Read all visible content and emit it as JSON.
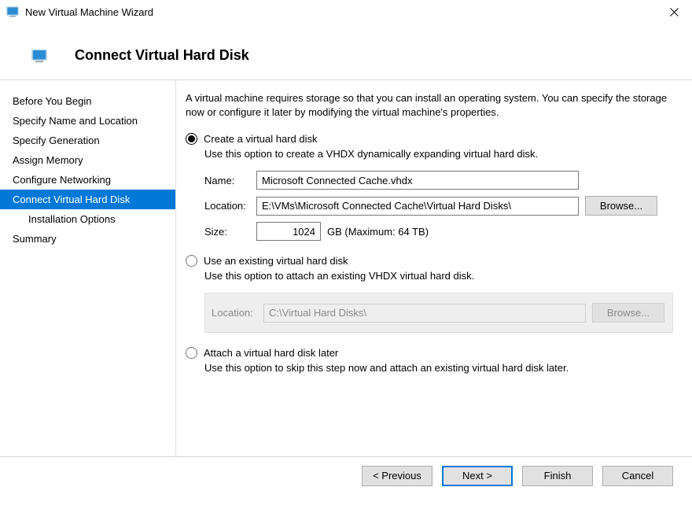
{
  "titlebar": {
    "title": "New Virtual Machine Wizard"
  },
  "header": {
    "heading": "Connect Virtual Hard Disk"
  },
  "sidebar": {
    "items": [
      {
        "label": "Before You Begin",
        "selected": false,
        "indented": false
      },
      {
        "label": "Specify Name and Location",
        "selected": false,
        "indented": false
      },
      {
        "label": "Specify Generation",
        "selected": false,
        "indented": false
      },
      {
        "label": "Assign Memory",
        "selected": false,
        "indented": false
      },
      {
        "label": "Configure Networking",
        "selected": false,
        "indented": false
      },
      {
        "label": "Connect Virtual Hard Disk",
        "selected": true,
        "indented": false
      },
      {
        "label": "Installation Options",
        "selected": false,
        "indented": true
      },
      {
        "label": "Summary",
        "selected": false,
        "indented": false
      }
    ]
  },
  "content": {
    "intro": "A virtual machine requires storage so that you can install an operating system. You can specify the storage now or configure it later by modifying the virtual machine's properties.",
    "option1": {
      "label": "Create a virtual hard disk",
      "desc": "Use this option to create a VHDX dynamically expanding virtual hard disk.",
      "name_label": "Name:",
      "name_value": "Microsoft Connected Cache.vhdx",
      "location_label": "Location:",
      "location_value": "E:\\VMs\\Microsoft Connected Cache\\Virtual Hard Disks\\",
      "browse_label": "Browse...",
      "size_label": "Size:",
      "size_value": "1024",
      "size_unit": "GB (Maximum: 64 TB)"
    },
    "option2": {
      "label": "Use an existing virtual hard disk",
      "desc": "Use this option to attach an existing VHDX virtual hard disk.",
      "location_label": "Location:",
      "location_value": "C:\\Virtual Hard Disks\\",
      "browse_label": "Browse..."
    },
    "option3": {
      "label": "Attach a virtual hard disk later",
      "desc": "Use this option to skip this step now and attach an existing virtual hard disk later."
    }
  },
  "footer": {
    "previous": "< Previous",
    "next": "Next >",
    "finish": "Finish",
    "cancel": "Cancel"
  }
}
